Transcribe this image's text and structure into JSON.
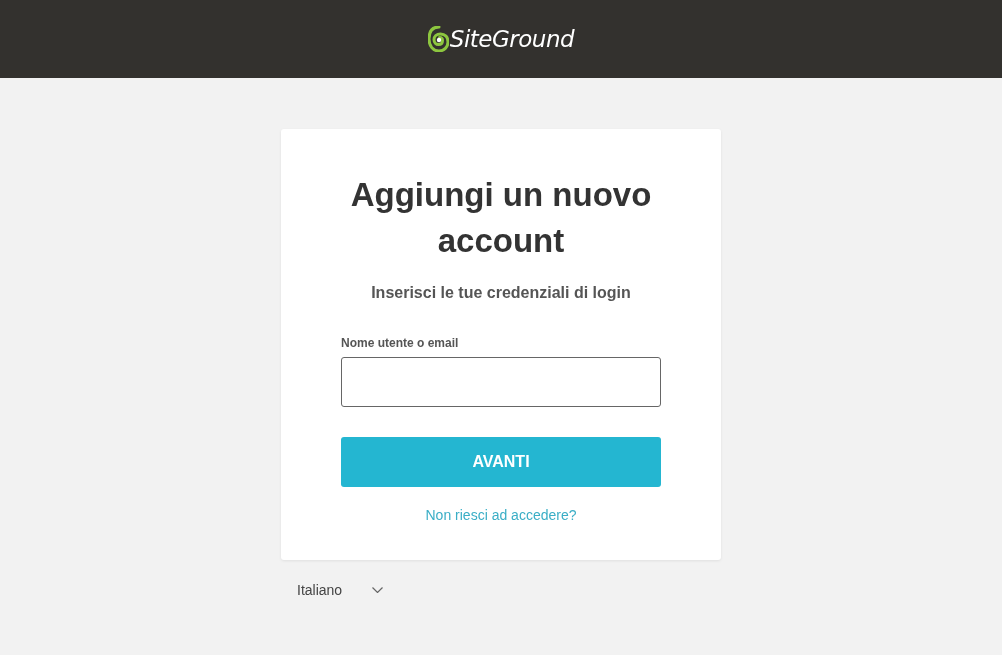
{
  "header": {
    "logo_text": "SiteGround"
  },
  "card": {
    "title": "Aggiungi un nuovo account",
    "subtitle": "Inserisci le tue credenziali di login",
    "field": {
      "label": "Nome utente o email"
    },
    "button": "AVANTI",
    "link": "Non riesci ad accedere?"
  },
  "language_select": {
    "value": "Italiano"
  }
}
